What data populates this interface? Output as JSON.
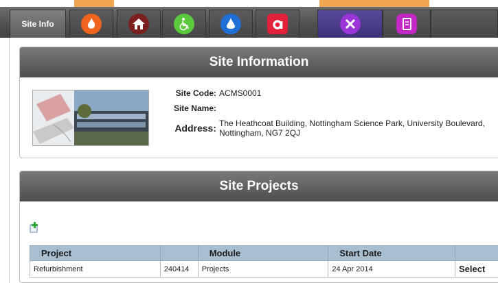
{
  "tabs": {
    "site_info_label": "Site Info",
    "items": [
      {
        "icon": "fire-icon",
        "color": "#f0641e"
      },
      {
        "icon": "house-icon",
        "color": "#7a1e1e"
      },
      {
        "icon": "wheelchair-icon",
        "color": "#5cc93c"
      },
      {
        "icon": "water-drop-icon",
        "color": "#1f6fd6"
      },
      {
        "icon": "asbestos-a-icon",
        "color": "#e2203a"
      },
      {
        "icon": "tools-icon",
        "color": "#9b35d9"
      },
      {
        "icon": "notebook-icon",
        "color": "#c327c6"
      }
    ]
  },
  "site_information": {
    "title": "Site Information",
    "site_code_label": "Site Code:",
    "site_code": "ACMS0001",
    "site_name_label": "Site Name:",
    "site_name": "",
    "address_label": "Address:",
    "address": "The Heathcoat Building, Nottingham Science Park, University Boulevard, Nottingham, NG7 2QJ"
  },
  "site_projects": {
    "title": "Site Projects",
    "columns": [
      "Project",
      "",
      "Module",
      "Start Date",
      ""
    ],
    "rows": [
      {
        "project": "Refurbishment",
        "id": "240414",
        "module": "Projects",
        "start_date": "24 Apr 2014",
        "action": "Select"
      }
    ]
  }
}
